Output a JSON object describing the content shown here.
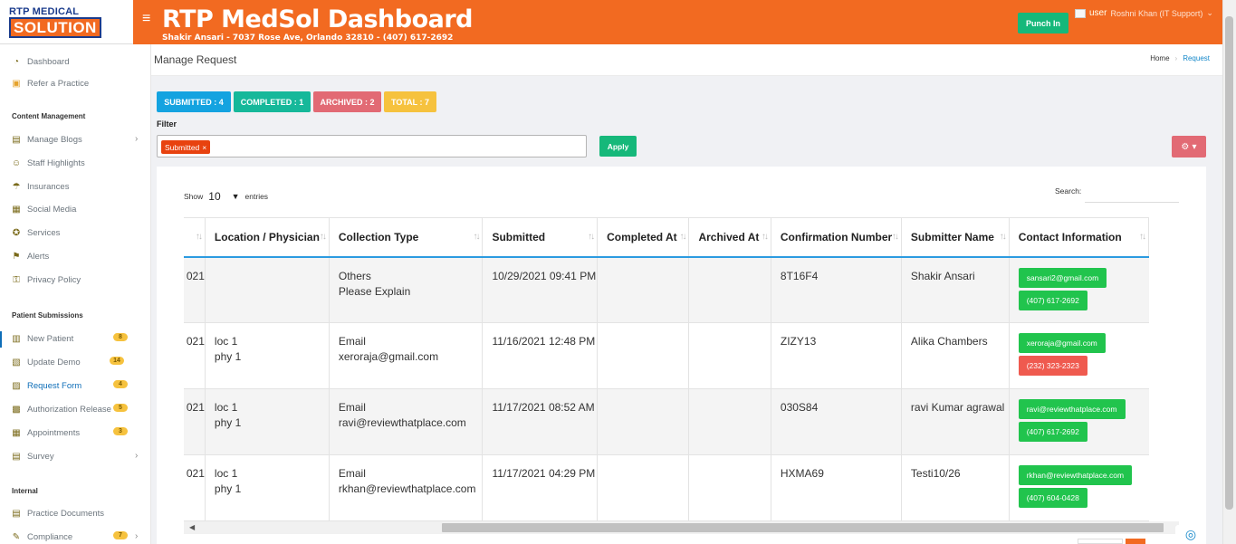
{
  "logo": {
    "top": "RTP MEDICAL",
    "bottom": "SOLUTION"
  },
  "header": {
    "title": "RTP MedSol Dashboard",
    "subtitle": "Shakir Ansari - 7037 Rose Ave, Orlando 32810 - (407) 617-2692",
    "punch_in": "Punch In",
    "user_alt": "user",
    "user_name": "Roshni Khan (IT Support)"
  },
  "sidebar": {
    "top_items": [
      {
        "label": "Dashboard",
        "icon": "gauge-icon"
      },
      {
        "label": "Refer a Practice",
        "icon": "gift-icon"
      }
    ],
    "content_management": "Content Management",
    "content_items": [
      {
        "label": "Manage Blogs",
        "icon": "blog-icon"
      },
      {
        "label": "Staff Highlights",
        "icon": "staff-icon"
      },
      {
        "label": "Insurances",
        "icon": "insurance-icon"
      },
      {
        "label": "Social Media",
        "icon": "social-icon"
      },
      {
        "label": "Services",
        "icon": "services-icon"
      },
      {
        "label": "Alerts",
        "icon": "alert-icon"
      },
      {
        "label": "Privacy Policy",
        "icon": "privacy-icon"
      }
    ],
    "patient_submissions": "Patient Submissions",
    "patient_items": [
      {
        "label": "New Patient",
        "badge": "8"
      },
      {
        "label": "Update Demo",
        "badge": "14"
      },
      {
        "label": "Request Form",
        "badge": "4"
      },
      {
        "label": "Authorization Release",
        "badge": "5"
      },
      {
        "label": "Appointments",
        "badge": "3"
      },
      {
        "label": "Survey",
        "badge": ""
      }
    ],
    "internal": "Internal",
    "internal_items": [
      {
        "label": "Practice Documents",
        "badge": ""
      },
      {
        "label": "Compliance",
        "badge": "7"
      }
    ]
  },
  "page": {
    "title": "Manage Request",
    "breadcrumb_home": "Home",
    "breadcrumb_current": "Request"
  },
  "status": {
    "submitted": "SUBMITTED : 4",
    "completed": "COMPLETED : 1",
    "archived": "ARCHIVED : 2",
    "total": "TOTAL : 7"
  },
  "filter": {
    "label": "Filter",
    "tag": "Submitted",
    "tag_remove": "×",
    "apply": "Apply"
  },
  "table": {
    "show": "Show",
    "page_size": "10",
    "entries": "entries",
    "search_label": "Search:",
    "columns": [
      "",
      "Location / Physician",
      "Collection Type",
      "Submitted",
      "Completed At",
      "Archived At",
      "Confirmation Number",
      "Submitter Name",
      "Contact Information"
    ],
    "rows": [
      {
        "first": "021",
        "location": [
          "",
          ""
        ],
        "collection": [
          "Others",
          "Please Explain"
        ],
        "submitted": "10/29/2021 09:41 PM",
        "completed": "",
        "archived": "",
        "confirmation": "8T16F4",
        "submitter": "Shakir Ansari",
        "email": "sansari2@gmail.com",
        "phone": "(407) 617-2692",
        "phone_red": false
      },
      {
        "first": "021",
        "location": [
          "loc 1",
          "phy 1"
        ],
        "collection": [
          "Email",
          "xeroraja@gmail.com"
        ],
        "submitted": "11/16/2021 12:48 PM",
        "completed": "",
        "archived": "",
        "confirmation": "ZIZY13",
        "submitter": "Alika Chambers",
        "email": "xeroraja@gmail.com",
        "phone": "(232) 323-2323",
        "phone_red": true
      },
      {
        "first": "021",
        "location": [
          "loc 1",
          "phy 1"
        ],
        "collection": [
          "Email",
          "ravi@reviewthatplace.com"
        ],
        "submitted": "11/17/2021 08:52 AM",
        "completed": "",
        "archived": "",
        "confirmation": "030S84",
        "submitter": "ravi Kumar agrawal",
        "email": "ravi@reviewthatplace.com",
        "phone": "(407) 617-2692",
        "phone_red": false
      },
      {
        "first": "021",
        "location": [
          "loc 1",
          "phy 1"
        ],
        "collection": [
          "Email",
          "rkhan@reviewthatplace.com"
        ],
        "submitted": "11/17/2021 04:29 PM",
        "completed": "",
        "archived": "",
        "confirmation": "HXMA69",
        "submitter": "Testi10/26",
        "email": "rkhan@reviewthatplace.com",
        "phone": "(407) 604-0428",
        "phone_red": false
      }
    ]
  },
  "colors": {
    "brand_orange": "#f26a21",
    "submitted": "#14a3e0",
    "completed": "#16b89a",
    "archived": "#e26a74",
    "total": "#f6c23e",
    "contact_green": "#21c44d",
    "contact_red": "#ef5a4f"
  }
}
